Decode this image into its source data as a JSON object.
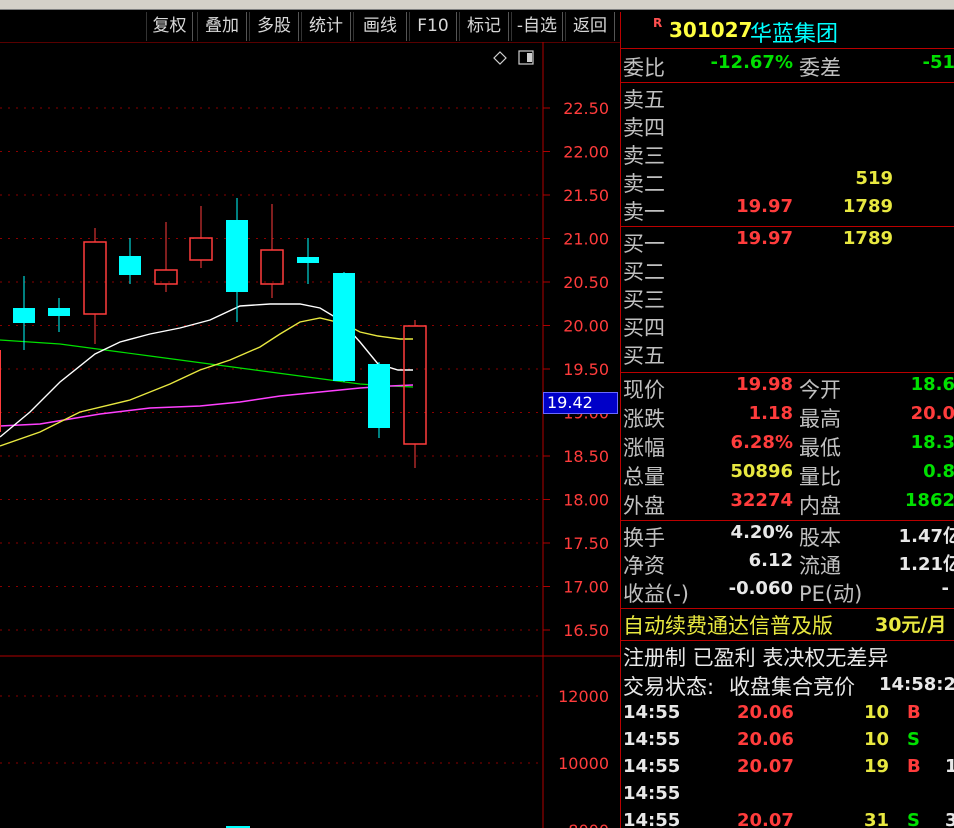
{
  "toolbar": {
    "buttons": [
      "复权",
      "叠加",
      "多股",
      "统计",
      "画线",
      "F10",
      "标记",
      "-自选",
      "返回"
    ]
  },
  "chart": {
    "price_axis": [
      "22.50",
      "22.00",
      "21.50",
      "21.00",
      "20.50",
      "20.00",
      "19.50",
      "19.00",
      "18.50",
      "18.00",
      "17.50",
      "17.00",
      "16.50"
    ],
    "volume_axis": [
      "12000",
      "10000",
      "8000"
    ],
    "current_price_tag": "19.42",
    "colors": {
      "up": "#ff3c3c",
      "down": "#00ffff",
      "ma5": "#ffffff",
      "ma10": "#e8e840",
      "ma20": "#ff40ff",
      "ma60": "#00e000",
      "grid": "#b00000"
    }
  },
  "quote": {
    "market_badge": "R",
    "code": "301027",
    "name": "华蓝集团",
    "weibi_label": "委比",
    "weibi_value": "-12.67%",
    "weicha_label": "委差",
    "weicha_value": "-51",
    "sell": [
      {
        "label": "卖五",
        "price": "",
        "vol": ""
      },
      {
        "label": "卖四",
        "price": "",
        "vol": ""
      },
      {
        "label": "卖三",
        "price": "",
        "vol": ""
      },
      {
        "label": "卖二",
        "price": "",
        "vol": "519"
      },
      {
        "label": "卖一",
        "price": "19.97",
        "vol": "1789"
      }
    ],
    "buy": [
      {
        "label": "买一",
        "price": "19.97",
        "vol": "1789"
      },
      {
        "label": "买二",
        "price": "",
        "vol": ""
      },
      {
        "label": "买三",
        "price": "",
        "vol": ""
      },
      {
        "label": "买四",
        "price": "",
        "vol": ""
      },
      {
        "label": "买五",
        "price": "",
        "vol": ""
      }
    ],
    "stats": [
      {
        "l1": "现价",
        "v1": "19.98",
        "c1": "red",
        "l2": "今开",
        "v2": "18.6",
        "c2": "green"
      },
      {
        "l1": "涨跌",
        "v1": "1.18",
        "c1": "red",
        "l2": "最高",
        "v2": "20.0",
        "c2": "red"
      },
      {
        "l1": "涨幅",
        "v1": "6.28%",
        "c1": "red",
        "l2": "最低",
        "v2": "18.3",
        "c2": "green"
      },
      {
        "l1": "总量",
        "v1": "50896",
        "c1": "yellow",
        "l2": "量比",
        "v2": "0.8",
        "c2": "green"
      },
      {
        "l1": "外盘",
        "v1": "32274",
        "c1": "red",
        "l2": "内盘",
        "v2": "1862",
        "c2": "green"
      }
    ],
    "fin": [
      {
        "l1": "换手",
        "v1": "4.20%",
        "l2": "股本",
        "v2": "1.47亿"
      },
      {
        "l1": "净资",
        "v1": "6.12",
        "l2": "流通",
        "v2": "1.21亿"
      },
      {
        "l1": "收益(-)",
        "v1": "-0.060",
        "l2": "PE(动)",
        "v2": "-"
      }
    ],
    "ad_text": "自动续费通达信普及版",
    "ad_price": "30元/月",
    "tags": "注册制 已盈利 表决权无差异",
    "trade_status_label": "交易状态:",
    "trade_status_value": "收盘集合竞价",
    "trade_time": "14:58:2",
    "ticks": [
      {
        "time": "14:55",
        "price": "20.06",
        "vol": "10",
        "side": "B",
        "extra": ""
      },
      {
        "time": "14:55",
        "price": "20.06",
        "vol": "10",
        "side": "S",
        "extra": ""
      },
      {
        "time": "14:55",
        "price": "20.07",
        "vol": "19",
        "side": "B",
        "extra": "1"
      },
      {
        "time": "14:55",
        "price": "",
        "vol": "",
        "side": "",
        "extra": ""
      },
      {
        "time": "14:55",
        "price": "20.07",
        "vol": "31",
        "side": "S",
        "extra": "3"
      }
    ]
  }
}
